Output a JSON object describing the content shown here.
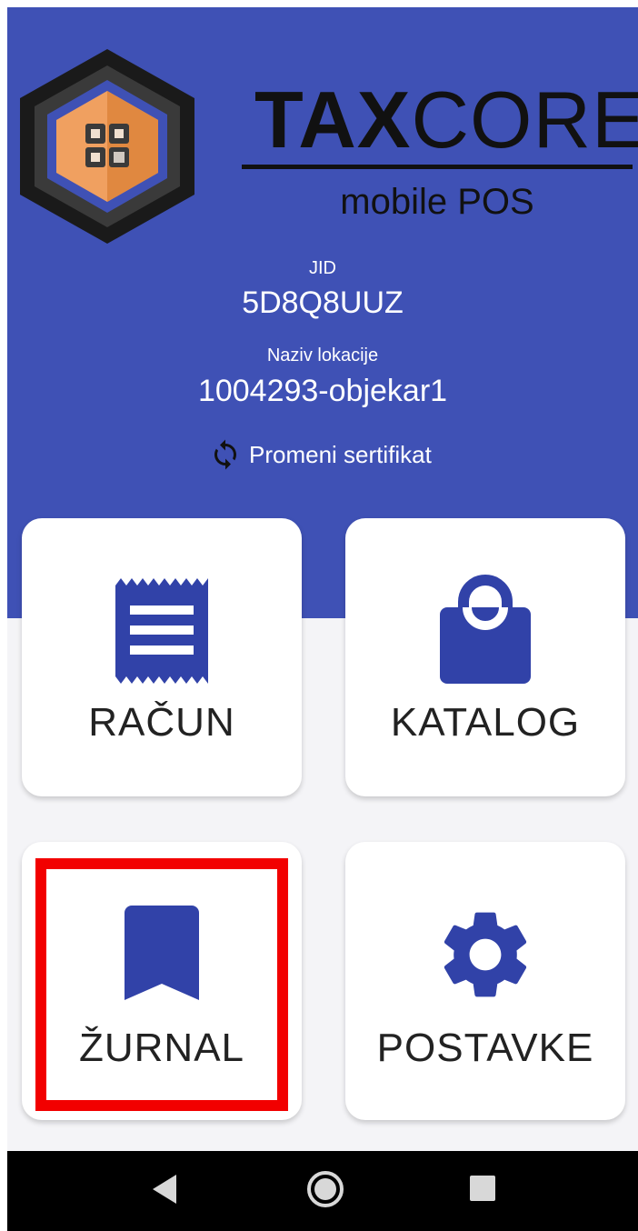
{
  "brand": {
    "title_bold": "TAX",
    "title_light": "CORE",
    "subtitle": "mobile POS"
  },
  "info": {
    "jid_label": "JID",
    "jid_value": "5D8Q8UUZ",
    "location_label": "Naziv lokacije",
    "location_value": "1004293-objekar1"
  },
  "change_certificate": {
    "label": "Promeni sertifikat",
    "icon": "sync-icon"
  },
  "tiles": [
    {
      "label": "RAČUN",
      "icon": "receipt-icon"
    },
    {
      "label": "KATALOG",
      "icon": "shopping-bag-icon"
    },
    {
      "label": "ŽURNAL",
      "icon": "bookmark-icon"
    },
    {
      "label": "POSTAVKE",
      "icon": "gear-icon"
    }
  ],
  "navigation": {
    "back_icon": "back-triangle-icon",
    "home_icon": "home-circle-icon",
    "recents_icon": "recents-square-icon"
  },
  "colors": {
    "primary": "#3f51b5",
    "icon": "#3142a8",
    "highlight": "#f20000",
    "logo_orange": "#e8914a"
  }
}
